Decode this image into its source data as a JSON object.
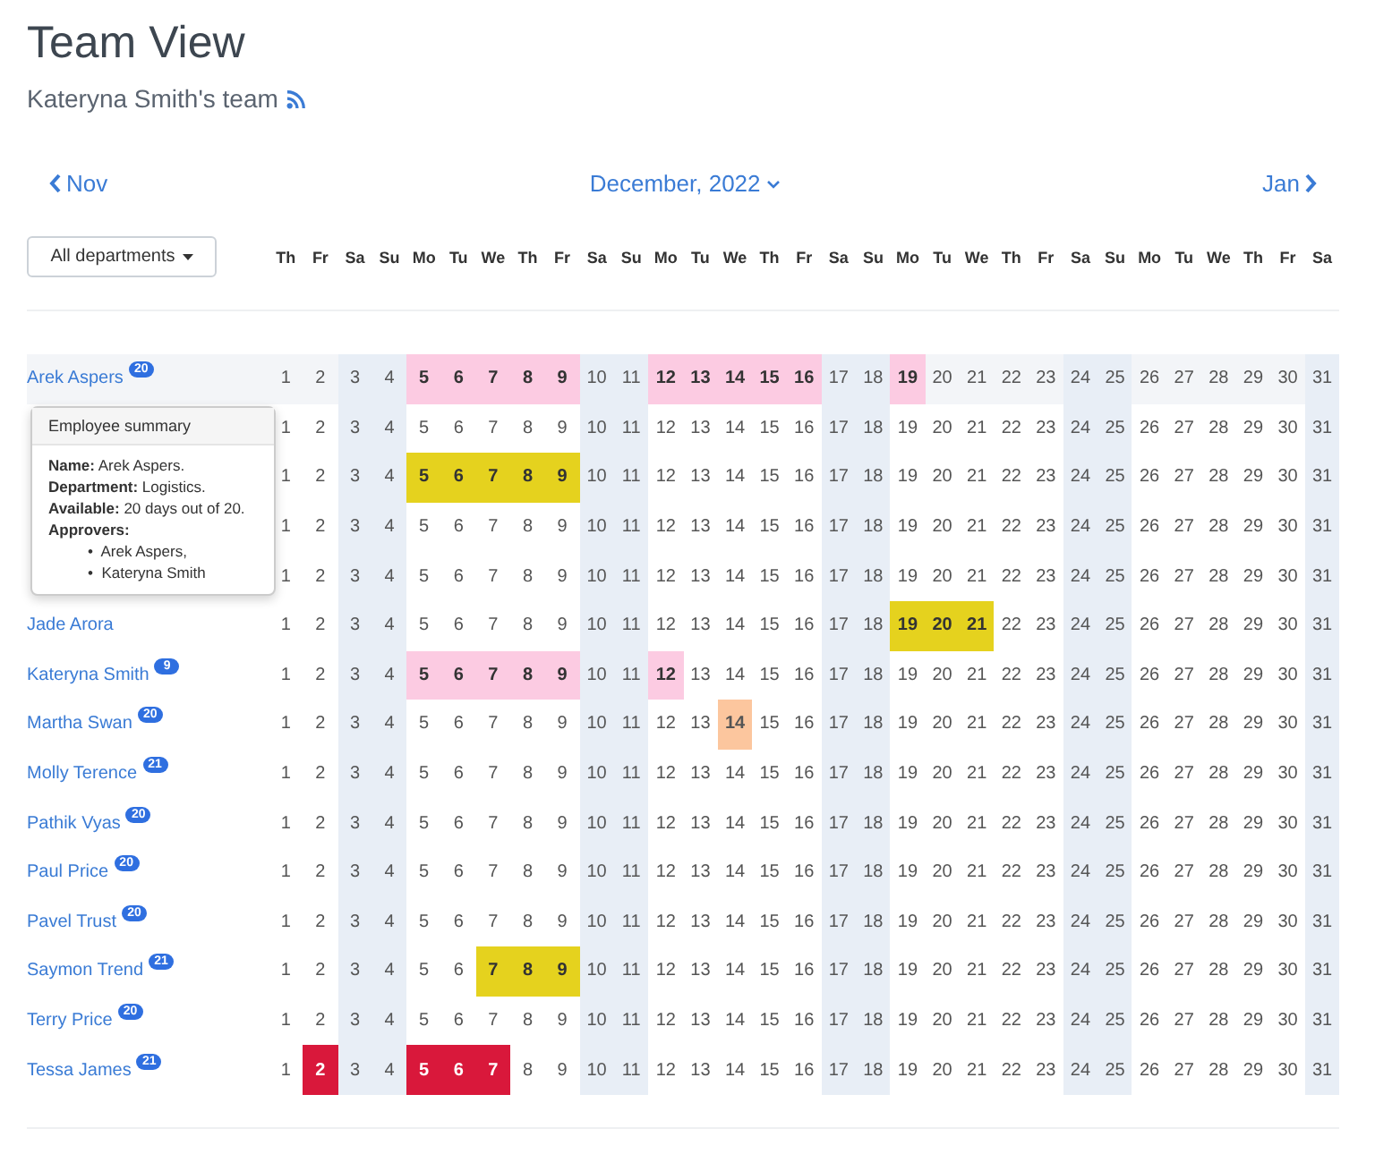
{
  "title": "Team View",
  "subtitle": "Kateryna Smith's team",
  "nav": {
    "prev": "Nov",
    "current": "December, 2022",
    "next": "Jan"
  },
  "department_filter": "All departments",
  "weekdays": [
    "Th",
    "Fr",
    "Sa",
    "Su",
    "Mo",
    "Tu",
    "We",
    "Th",
    "Fr",
    "Sa",
    "Su",
    "Mo",
    "Tu",
    "We",
    "Th",
    "Fr",
    "Sa",
    "Su",
    "Mo",
    "Tu",
    "We",
    "Th",
    "Fr",
    "Sa",
    "Su",
    "Mo",
    "Tu",
    "We",
    "Th",
    "Fr",
    "Sa"
  ],
  "rows": [
    {
      "name": "Arek Aspers",
      "badge": "20",
      "hovered": true,
      "days": [
        {
          "d": "1"
        },
        {
          "d": "2"
        },
        {
          "d": "3",
          "kind": "weekend"
        },
        {
          "d": "4",
          "kind": "weekend"
        },
        {
          "d": "5",
          "kind": "holiday"
        },
        {
          "d": "6",
          "kind": "holiday"
        },
        {
          "d": "7",
          "kind": "holiday"
        },
        {
          "d": "8",
          "kind": "holiday"
        },
        {
          "d": "9",
          "kind": "holiday"
        },
        {
          "d": "10",
          "kind": "weekend"
        },
        {
          "d": "11",
          "kind": "weekend"
        },
        {
          "d": "12",
          "kind": "holiday"
        },
        {
          "d": "13",
          "kind": "holiday"
        },
        {
          "d": "14",
          "kind": "holiday"
        },
        {
          "d": "15",
          "kind": "holiday"
        },
        {
          "d": "16",
          "kind": "holiday"
        },
        {
          "d": "17",
          "kind": "weekend"
        },
        {
          "d": "18",
          "kind": "weekend"
        },
        {
          "d": "19",
          "kind": "holiday"
        },
        {
          "d": "20"
        },
        {
          "d": "21"
        },
        {
          "d": "22"
        },
        {
          "d": "23"
        },
        {
          "d": "24",
          "kind": "weekend"
        },
        {
          "d": "25",
          "kind": "weekend"
        },
        {
          "d": "26"
        },
        {
          "d": "27"
        },
        {
          "d": "28"
        },
        {
          "d": "29"
        },
        {
          "d": "30"
        },
        {
          "d": "31",
          "kind": "weekend"
        }
      ]
    },
    {
      "hovered": false,
      "days": [
        {
          "d": "1"
        },
        {
          "d": "2"
        },
        {
          "d": "3",
          "kind": "weekend"
        },
        {
          "d": "4",
          "kind": "weekend"
        },
        {
          "d": "5"
        },
        {
          "d": "6"
        },
        {
          "d": "7"
        },
        {
          "d": "8"
        },
        {
          "d": "9"
        },
        {
          "d": "10",
          "kind": "weekend"
        },
        {
          "d": "11",
          "kind": "weekend"
        },
        {
          "d": "12"
        },
        {
          "d": "13"
        },
        {
          "d": "14"
        },
        {
          "d": "15"
        },
        {
          "d": "16"
        },
        {
          "d": "17",
          "kind": "weekend"
        },
        {
          "d": "18",
          "kind": "weekend"
        },
        {
          "d": "19"
        },
        {
          "d": "20"
        },
        {
          "d": "21"
        },
        {
          "d": "22"
        },
        {
          "d": "23"
        },
        {
          "d": "24",
          "kind": "weekend"
        },
        {
          "d": "25",
          "kind": "weekend"
        },
        {
          "d": "26"
        },
        {
          "d": "27"
        },
        {
          "d": "28"
        },
        {
          "d": "29"
        },
        {
          "d": "30"
        },
        {
          "d": "31",
          "kind": "weekend"
        }
      ]
    },
    {
      "hovered": false,
      "days": [
        {
          "d": "1"
        },
        {
          "d": "2"
        },
        {
          "d": "3",
          "kind": "weekend"
        },
        {
          "d": "4",
          "kind": "weekend"
        },
        {
          "d": "5",
          "kind": "pending"
        },
        {
          "d": "6",
          "kind": "pending"
        },
        {
          "d": "7",
          "kind": "pending"
        },
        {
          "d": "8",
          "kind": "pending"
        },
        {
          "d": "9",
          "kind": "pending"
        },
        {
          "d": "10",
          "kind": "weekend"
        },
        {
          "d": "11",
          "kind": "weekend"
        },
        {
          "d": "12"
        },
        {
          "d": "13"
        },
        {
          "d": "14"
        },
        {
          "d": "15"
        },
        {
          "d": "16"
        },
        {
          "d": "17",
          "kind": "weekend"
        },
        {
          "d": "18",
          "kind": "weekend"
        },
        {
          "d": "19"
        },
        {
          "d": "20"
        },
        {
          "d": "21"
        },
        {
          "d": "22"
        },
        {
          "d": "23"
        },
        {
          "d": "24",
          "kind": "weekend"
        },
        {
          "d": "25",
          "kind": "weekend"
        },
        {
          "d": "26"
        },
        {
          "d": "27"
        },
        {
          "d": "28"
        },
        {
          "d": "29"
        },
        {
          "d": "30"
        },
        {
          "d": "31",
          "kind": "weekend"
        }
      ]
    },
    {
      "hovered": false,
      "days": [
        {
          "d": "1"
        },
        {
          "d": "2"
        },
        {
          "d": "3",
          "kind": "weekend"
        },
        {
          "d": "4",
          "kind": "weekend"
        },
        {
          "d": "5"
        },
        {
          "d": "6"
        },
        {
          "d": "7"
        },
        {
          "d": "8"
        },
        {
          "d": "9"
        },
        {
          "d": "10",
          "kind": "weekend"
        },
        {
          "d": "11",
          "kind": "weekend"
        },
        {
          "d": "12"
        },
        {
          "d": "13"
        },
        {
          "d": "14"
        },
        {
          "d": "15"
        },
        {
          "d": "16"
        },
        {
          "d": "17",
          "kind": "weekend"
        },
        {
          "d": "18",
          "kind": "weekend"
        },
        {
          "d": "19"
        },
        {
          "d": "20"
        },
        {
          "d": "21"
        },
        {
          "d": "22"
        },
        {
          "d": "23"
        },
        {
          "d": "24",
          "kind": "weekend"
        },
        {
          "d": "25",
          "kind": "weekend"
        },
        {
          "d": "26"
        },
        {
          "d": "27"
        },
        {
          "d": "28"
        },
        {
          "d": "29"
        },
        {
          "d": "30"
        },
        {
          "d": "31",
          "kind": "weekend"
        }
      ]
    },
    {
      "hovered": false,
      "days": [
        {
          "d": "1"
        },
        {
          "d": "2"
        },
        {
          "d": "3",
          "kind": "weekend"
        },
        {
          "d": "4",
          "kind": "weekend"
        },
        {
          "d": "5"
        },
        {
          "d": "6"
        },
        {
          "d": "7"
        },
        {
          "d": "8"
        },
        {
          "d": "9"
        },
        {
          "d": "10",
          "kind": "weekend"
        },
        {
          "d": "11",
          "kind": "weekend"
        },
        {
          "d": "12"
        },
        {
          "d": "13"
        },
        {
          "d": "14"
        },
        {
          "d": "15"
        },
        {
          "d": "16"
        },
        {
          "d": "17",
          "kind": "weekend"
        },
        {
          "d": "18",
          "kind": "weekend"
        },
        {
          "d": "19"
        },
        {
          "d": "20"
        },
        {
          "d": "21"
        },
        {
          "d": "22"
        },
        {
          "d": "23"
        },
        {
          "d": "24",
          "kind": "weekend"
        },
        {
          "d": "25",
          "kind": "weekend"
        },
        {
          "d": "26"
        },
        {
          "d": "27"
        },
        {
          "d": "28"
        },
        {
          "d": "29"
        },
        {
          "d": "30"
        },
        {
          "d": "31",
          "kind": "weekend"
        }
      ]
    },
    {
      "name": "Jade Arora",
      "hovered": false,
      "days": [
        {
          "d": "1"
        },
        {
          "d": "2"
        },
        {
          "d": "3",
          "kind": "weekend"
        },
        {
          "d": "4",
          "kind": "weekend"
        },
        {
          "d": "5"
        },
        {
          "d": "6"
        },
        {
          "d": "7"
        },
        {
          "d": "8"
        },
        {
          "d": "9"
        },
        {
          "d": "10",
          "kind": "weekend"
        },
        {
          "d": "11",
          "kind": "weekend"
        },
        {
          "d": "12"
        },
        {
          "d": "13"
        },
        {
          "d": "14"
        },
        {
          "d": "15"
        },
        {
          "d": "16"
        },
        {
          "d": "17",
          "kind": "weekend"
        },
        {
          "d": "18",
          "kind": "weekend"
        },
        {
          "d": "19",
          "kind": "pending"
        },
        {
          "d": "20",
          "kind": "pending"
        },
        {
          "d": "21",
          "kind": "pending"
        },
        {
          "d": "22"
        },
        {
          "d": "23"
        },
        {
          "d": "24",
          "kind": "weekend"
        },
        {
          "d": "25",
          "kind": "weekend"
        },
        {
          "d": "26"
        },
        {
          "d": "27"
        },
        {
          "d": "28"
        },
        {
          "d": "29"
        },
        {
          "d": "30"
        },
        {
          "d": "31",
          "kind": "weekend"
        }
      ]
    },
    {
      "name": "Kateryna Smith",
      "badge": "9",
      "hovered": false,
      "days": [
        {
          "d": "1"
        },
        {
          "d": "2"
        },
        {
          "d": "3",
          "kind": "weekend"
        },
        {
          "d": "4",
          "kind": "weekend"
        },
        {
          "d": "5",
          "kind": "holiday"
        },
        {
          "d": "6",
          "kind": "holiday"
        },
        {
          "d": "7",
          "kind": "holiday"
        },
        {
          "d": "8",
          "kind": "holiday"
        },
        {
          "d": "9",
          "kind": "holiday"
        },
        {
          "d": "10",
          "kind": "weekend"
        },
        {
          "d": "11",
          "kind": "weekend"
        },
        {
          "d": "12",
          "kind": "holiday"
        },
        {
          "d": "13"
        },
        {
          "d": "14"
        },
        {
          "d": "15"
        },
        {
          "d": "16"
        },
        {
          "d": "17",
          "kind": "weekend"
        },
        {
          "d": "18",
          "kind": "weekend"
        },
        {
          "d": "19"
        },
        {
          "d": "20"
        },
        {
          "d": "21"
        },
        {
          "d": "22"
        },
        {
          "d": "23"
        },
        {
          "d": "24",
          "kind": "weekend"
        },
        {
          "d": "25",
          "kind": "weekend"
        },
        {
          "d": "26"
        },
        {
          "d": "27"
        },
        {
          "d": "28"
        },
        {
          "d": "29"
        },
        {
          "d": "30"
        },
        {
          "d": "31",
          "kind": "weekend"
        }
      ]
    },
    {
      "name": "Martha Swan",
      "badge": "20",
      "hovered": false,
      "days": [
        {
          "d": "1"
        },
        {
          "d": "2"
        },
        {
          "d": "3",
          "kind": "weekend"
        },
        {
          "d": "4",
          "kind": "weekend"
        },
        {
          "d": "5"
        },
        {
          "d": "6"
        },
        {
          "d": "7"
        },
        {
          "d": "8"
        },
        {
          "d": "9"
        },
        {
          "d": "10",
          "kind": "weekend"
        },
        {
          "d": "11",
          "kind": "weekend"
        },
        {
          "d": "12"
        },
        {
          "d": "13"
        },
        {
          "d": "14",
          "kind": "partial"
        },
        {
          "d": "15"
        },
        {
          "d": "16"
        },
        {
          "d": "17",
          "kind": "weekend"
        },
        {
          "d": "18",
          "kind": "weekend"
        },
        {
          "d": "19"
        },
        {
          "d": "20"
        },
        {
          "d": "21"
        },
        {
          "d": "22"
        },
        {
          "d": "23"
        },
        {
          "d": "24",
          "kind": "weekend"
        },
        {
          "d": "25",
          "kind": "weekend"
        },
        {
          "d": "26"
        },
        {
          "d": "27"
        },
        {
          "d": "28"
        },
        {
          "d": "29"
        },
        {
          "d": "30"
        },
        {
          "d": "31",
          "kind": "weekend"
        }
      ]
    },
    {
      "name": "Molly Terence",
      "badge": "21",
      "hovered": false,
      "days": [
        {
          "d": "1"
        },
        {
          "d": "2"
        },
        {
          "d": "3",
          "kind": "weekend"
        },
        {
          "d": "4",
          "kind": "weekend"
        },
        {
          "d": "5"
        },
        {
          "d": "6"
        },
        {
          "d": "7"
        },
        {
          "d": "8"
        },
        {
          "d": "9"
        },
        {
          "d": "10",
          "kind": "weekend"
        },
        {
          "d": "11",
          "kind": "weekend"
        },
        {
          "d": "12"
        },
        {
          "d": "13"
        },
        {
          "d": "14"
        },
        {
          "d": "15"
        },
        {
          "d": "16"
        },
        {
          "d": "17",
          "kind": "weekend"
        },
        {
          "d": "18",
          "kind": "weekend"
        },
        {
          "d": "19"
        },
        {
          "d": "20"
        },
        {
          "d": "21"
        },
        {
          "d": "22"
        },
        {
          "d": "23"
        },
        {
          "d": "24",
          "kind": "weekend"
        },
        {
          "d": "25",
          "kind": "weekend"
        },
        {
          "d": "26"
        },
        {
          "d": "27"
        },
        {
          "d": "28"
        },
        {
          "d": "29"
        },
        {
          "d": "30"
        },
        {
          "d": "31",
          "kind": "weekend"
        }
      ]
    },
    {
      "name": "Pathik Vyas",
      "badge": "20",
      "hovered": false,
      "days": [
        {
          "d": "1"
        },
        {
          "d": "2"
        },
        {
          "d": "3",
          "kind": "weekend"
        },
        {
          "d": "4",
          "kind": "weekend"
        },
        {
          "d": "5"
        },
        {
          "d": "6"
        },
        {
          "d": "7"
        },
        {
          "d": "8"
        },
        {
          "d": "9"
        },
        {
          "d": "10",
          "kind": "weekend"
        },
        {
          "d": "11",
          "kind": "weekend"
        },
        {
          "d": "12"
        },
        {
          "d": "13"
        },
        {
          "d": "14"
        },
        {
          "d": "15"
        },
        {
          "d": "16"
        },
        {
          "d": "17",
          "kind": "weekend"
        },
        {
          "d": "18",
          "kind": "weekend"
        },
        {
          "d": "19"
        },
        {
          "d": "20"
        },
        {
          "d": "21"
        },
        {
          "d": "22"
        },
        {
          "d": "23"
        },
        {
          "d": "24",
          "kind": "weekend"
        },
        {
          "d": "25",
          "kind": "weekend"
        },
        {
          "d": "26"
        },
        {
          "d": "27"
        },
        {
          "d": "28"
        },
        {
          "d": "29"
        },
        {
          "d": "30"
        },
        {
          "d": "31",
          "kind": "weekend"
        }
      ]
    },
    {
      "name": "Paul Price",
      "badge": "20",
      "hovered": false,
      "days": [
        {
          "d": "1"
        },
        {
          "d": "2"
        },
        {
          "d": "3",
          "kind": "weekend"
        },
        {
          "d": "4",
          "kind": "weekend"
        },
        {
          "d": "5"
        },
        {
          "d": "6"
        },
        {
          "d": "7"
        },
        {
          "d": "8"
        },
        {
          "d": "9"
        },
        {
          "d": "10",
          "kind": "weekend"
        },
        {
          "d": "11",
          "kind": "weekend"
        },
        {
          "d": "12"
        },
        {
          "d": "13"
        },
        {
          "d": "14"
        },
        {
          "d": "15"
        },
        {
          "d": "16"
        },
        {
          "d": "17",
          "kind": "weekend"
        },
        {
          "d": "18",
          "kind": "weekend"
        },
        {
          "d": "19"
        },
        {
          "d": "20"
        },
        {
          "d": "21"
        },
        {
          "d": "22"
        },
        {
          "d": "23"
        },
        {
          "d": "24",
          "kind": "weekend"
        },
        {
          "d": "25",
          "kind": "weekend"
        },
        {
          "d": "26"
        },
        {
          "d": "27"
        },
        {
          "d": "28"
        },
        {
          "d": "29"
        },
        {
          "d": "30"
        },
        {
          "d": "31",
          "kind": "weekend"
        }
      ]
    },
    {
      "name": "Pavel Trust",
      "badge": "20",
      "hovered": false,
      "days": [
        {
          "d": "1"
        },
        {
          "d": "2"
        },
        {
          "d": "3",
          "kind": "weekend"
        },
        {
          "d": "4",
          "kind": "weekend"
        },
        {
          "d": "5"
        },
        {
          "d": "6"
        },
        {
          "d": "7"
        },
        {
          "d": "8"
        },
        {
          "d": "9"
        },
        {
          "d": "10",
          "kind": "weekend"
        },
        {
          "d": "11",
          "kind": "weekend"
        },
        {
          "d": "12"
        },
        {
          "d": "13"
        },
        {
          "d": "14"
        },
        {
          "d": "15"
        },
        {
          "d": "16"
        },
        {
          "d": "17",
          "kind": "weekend"
        },
        {
          "d": "18",
          "kind": "weekend"
        },
        {
          "d": "19"
        },
        {
          "d": "20"
        },
        {
          "d": "21"
        },
        {
          "d": "22"
        },
        {
          "d": "23"
        },
        {
          "d": "24",
          "kind": "weekend"
        },
        {
          "d": "25",
          "kind": "weekend"
        },
        {
          "d": "26"
        },
        {
          "d": "27"
        },
        {
          "d": "28"
        },
        {
          "d": "29"
        },
        {
          "d": "30"
        },
        {
          "d": "31",
          "kind": "weekend"
        }
      ]
    },
    {
      "name": "Saymon Trend",
      "badge": "21",
      "hovered": false,
      "days": [
        {
          "d": "1"
        },
        {
          "d": "2"
        },
        {
          "d": "3",
          "kind": "weekend"
        },
        {
          "d": "4",
          "kind": "weekend"
        },
        {
          "d": "5"
        },
        {
          "d": "6"
        },
        {
          "d": "7",
          "kind": "pending"
        },
        {
          "d": "8",
          "kind": "pending"
        },
        {
          "d": "9",
          "kind": "pending"
        },
        {
          "d": "10",
          "kind": "weekend"
        },
        {
          "d": "11",
          "kind": "weekend"
        },
        {
          "d": "12"
        },
        {
          "d": "13"
        },
        {
          "d": "14"
        },
        {
          "d": "15"
        },
        {
          "d": "16"
        },
        {
          "d": "17",
          "kind": "weekend"
        },
        {
          "d": "18",
          "kind": "weekend"
        },
        {
          "d": "19"
        },
        {
          "d": "20"
        },
        {
          "d": "21"
        },
        {
          "d": "22"
        },
        {
          "d": "23"
        },
        {
          "d": "24",
          "kind": "weekend"
        },
        {
          "d": "25",
          "kind": "weekend"
        },
        {
          "d": "26"
        },
        {
          "d": "27"
        },
        {
          "d": "28"
        },
        {
          "d": "29"
        },
        {
          "d": "30"
        },
        {
          "d": "31",
          "kind": "weekend"
        }
      ]
    },
    {
      "name": "Terry Price",
      "badge": "20",
      "hovered": false,
      "days": [
        {
          "d": "1"
        },
        {
          "d": "2"
        },
        {
          "d": "3",
          "kind": "weekend"
        },
        {
          "d": "4",
          "kind": "weekend"
        },
        {
          "d": "5"
        },
        {
          "d": "6"
        },
        {
          "d": "7"
        },
        {
          "d": "8"
        },
        {
          "d": "9"
        },
        {
          "d": "10",
          "kind": "weekend"
        },
        {
          "d": "11",
          "kind": "weekend"
        },
        {
          "d": "12"
        },
        {
          "d": "13"
        },
        {
          "d": "14"
        },
        {
          "d": "15"
        },
        {
          "d": "16"
        },
        {
          "d": "17",
          "kind": "weekend"
        },
        {
          "d": "18",
          "kind": "weekend"
        },
        {
          "d": "19"
        },
        {
          "d": "20"
        },
        {
          "d": "21"
        },
        {
          "d": "22"
        },
        {
          "d": "23"
        },
        {
          "d": "24",
          "kind": "weekend"
        },
        {
          "d": "25",
          "kind": "weekend"
        },
        {
          "d": "26"
        },
        {
          "d": "27"
        },
        {
          "d": "28"
        },
        {
          "d": "29"
        },
        {
          "d": "30"
        },
        {
          "d": "31",
          "kind": "weekend"
        }
      ]
    },
    {
      "name": "Tessa James",
      "badge": "21",
      "hovered": false,
      "days": [
        {
          "d": "1"
        },
        {
          "d": "2",
          "kind": "sick"
        },
        {
          "d": "3",
          "kind": "weekend"
        },
        {
          "d": "4",
          "kind": "weekend"
        },
        {
          "d": "5",
          "kind": "sick"
        },
        {
          "d": "6",
          "kind": "sick"
        },
        {
          "d": "7",
          "kind": "sick"
        },
        {
          "d": "8"
        },
        {
          "d": "9"
        },
        {
          "d": "10",
          "kind": "weekend"
        },
        {
          "d": "11",
          "kind": "weekend"
        },
        {
          "d": "12"
        },
        {
          "d": "13"
        },
        {
          "d": "14"
        },
        {
          "d": "15"
        },
        {
          "d": "16"
        },
        {
          "d": "17",
          "kind": "weekend"
        },
        {
          "d": "18",
          "kind": "weekend"
        },
        {
          "d": "19"
        },
        {
          "d": "20"
        },
        {
          "d": "21"
        },
        {
          "d": "22"
        },
        {
          "d": "23"
        },
        {
          "d": "24",
          "kind": "weekend"
        },
        {
          "d": "25",
          "kind": "weekend"
        },
        {
          "d": "26"
        },
        {
          "d": "27"
        },
        {
          "d": "28"
        },
        {
          "d": "29"
        },
        {
          "d": "30"
        },
        {
          "d": "31",
          "kind": "weekend"
        }
      ]
    }
  ],
  "tooltip": {
    "title": "Employee summary",
    "lines": [
      "**Name:** Arek Aspers.",
      "**Department:** Logistics.",
      "**Available:** 20 days out of 20."
    ],
    "list_title": "Approvers:",
    "approvers": [
      {
        "bullet": "•",
        "text": "Arek Aspers,"
      },
      {
        "bullet": "•",
        "text": "Kateryna Smith"
      }
    ]
  }
}
